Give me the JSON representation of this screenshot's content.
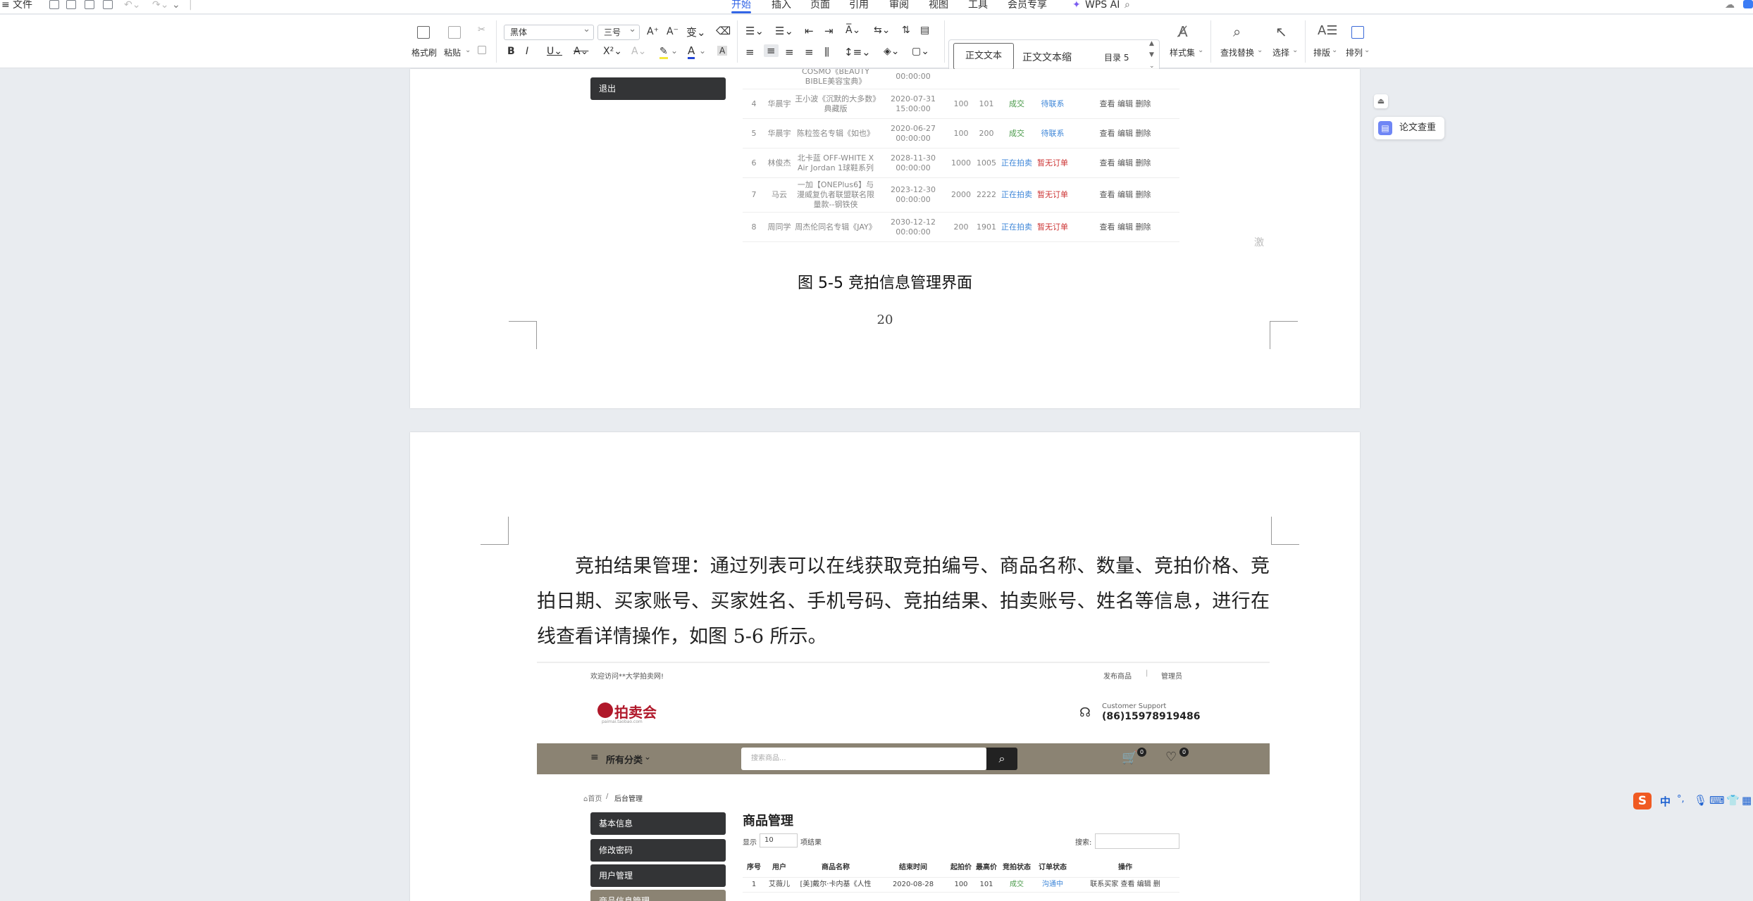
{
  "menu": {
    "file": "文件",
    "tabs": [
      "开始",
      "插入",
      "页面",
      "引用",
      "审阅",
      "视图",
      "工具",
      "会员专享"
    ],
    "active_tab": "开始",
    "wps_ai": "WPS AI"
  },
  "ribbon": {
    "format_painter": "格式刷",
    "paste": "粘贴",
    "font_name": "黑体",
    "font_size": "三号",
    "styles": [
      "正文文本",
      "正文文本缩",
      "目录 5"
    ],
    "style_set": "样式集",
    "find_replace": "查找替换",
    "select": "选择",
    "layout": "排版",
    "arrange": "排列"
  },
  "page1": {
    "logout": "退出",
    "rows": [
      {
        "no": "",
        "user": "",
        "name": "COSMO《BEAUTY BIBLE美容宝典》",
        "end": "00:00:00",
        "start": "",
        "max": "",
        "status": "",
        "order": "",
        "ops": ""
      },
      {
        "no": "4",
        "user": "华晨宇",
        "name": "王小波《沉默的大多数》典藏版",
        "end": "2020-07-31 15:00:00",
        "start": "100",
        "max": "101",
        "status": "成交",
        "order": "待联系",
        "ops": "查看 编辑 删除"
      },
      {
        "no": "5",
        "user": "华晨宇",
        "name": "陈粒签名专辑《如也》",
        "end": "2020-06-27 00:00:00",
        "start": "100",
        "max": "200",
        "status": "成交",
        "order": "待联系",
        "ops": "查看 编辑 删除"
      },
      {
        "no": "6",
        "user": "林俊杰",
        "name": "北卡蓝 OFF-WHITE X Air Jordan 1球鞋系列",
        "end": "2028-11-30 00:00:00",
        "start": "1000",
        "max": "1005",
        "status": "正在拍卖",
        "order": "暂无订单",
        "ops": "查看 编辑 删除"
      },
      {
        "no": "7",
        "user": "马云",
        "name": "一加【ONEPlus6】与漫威复仇者联盟联名限量款--钢铁侠",
        "end": "2023-12-30 00:00:00",
        "start": "2000",
        "max": "2222",
        "status": "正在拍卖",
        "order": "暂无订单",
        "ops": "查看 编辑 删除"
      },
      {
        "no": "8",
        "user": "周同学",
        "name": "周杰伦同名专辑《JAY》",
        "end": "2030-12-12 00:00:00",
        "start": "200",
        "max": "1901",
        "status": "正在拍卖",
        "order": "暂无订单",
        "ops": "查看 编辑 删除"
      }
    ],
    "caption": "图 5-5 竞拍信息管理界面",
    "page_number": "20",
    "watermark": "激"
  },
  "page2": {
    "paragraph": "竞拍结果管理：通过列表可以在线获取竞拍编号、商品名称、数量、竞拍价格、竞拍日期、买家账号、买家姓名、手机号码、竞拍结果、拍卖账号、姓名等信息，进行在线查看详情操作，如图 5-6 所示。",
    "shot": {
      "welcome": "欢迎访问**大学拍卖网!",
      "publish": "发布商品",
      "admin": "管理员",
      "logo": "拍卖会",
      "logo_sub": "paimai.taobao.com",
      "support_label": "Customer Support",
      "support_phone": "(86)15978919486",
      "all_categories": "所有分类",
      "search_placeholder": "搜索商品...",
      "cart_count": "0",
      "wish_count": "0",
      "breadcrumb_home": "首页",
      "breadcrumb_current": "后台管理",
      "side_menu": [
        "基本信息",
        "修改密码",
        "用户管理",
        "商品信息管理"
      ],
      "title": "商品管理",
      "show": "显示",
      "show_value": "10",
      "entries": "项结果",
      "search": "搜索:",
      "headers": [
        "序号",
        "用户",
        "商品名称",
        "结束时间",
        "起拍价",
        "最高价",
        "竞拍状态",
        "订单状态",
        "操作"
      ],
      "row": {
        "no": "1",
        "user": "艾薇儿",
        "name": "[美]戴尔·卡内基《人性",
        "end": "2020-08-28",
        "start": "100",
        "max": "101",
        "status": "成交",
        "order": "沟通中",
        "ops": "联系买家 查看 编辑 删"
      }
    }
  },
  "side": {
    "thesis_check": "论文查重"
  },
  "colors": {
    "accent": "#3365e6",
    "nav_bar": "#8b8373",
    "side_btn": "#333436"
  }
}
